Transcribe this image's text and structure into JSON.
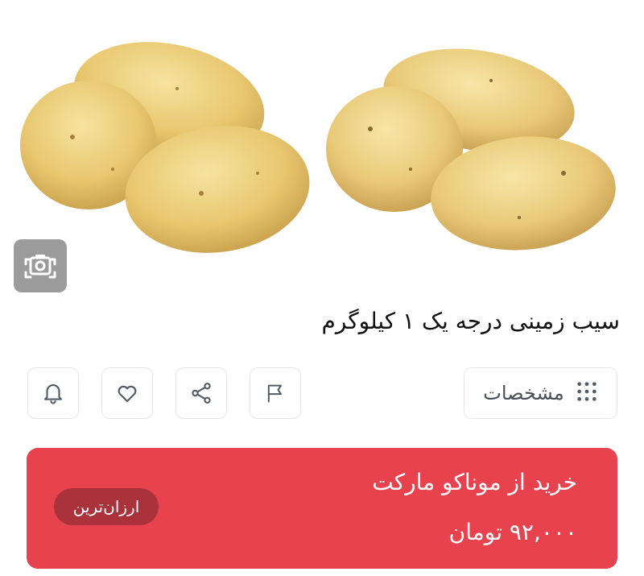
{
  "product": {
    "title": "سیب زمینی درجه یک ۱ کیلوگرم",
    "image_subject": "potatoes"
  },
  "gallery": {
    "camera_icon": "camera-icon"
  },
  "actions": {
    "specs_label": "مشخصات",
    "specs_icon": "grid-dots-icon",
    "icons": [
      "bell-icon",
      "heart-icon",
      "share-icon",
      "flag-icon"
    ]
  },
  "buy_card": {
    "title": "خرید از موناکو مارکت",
    "price": "۹۲,۰۰۰ تومان",
    "badge": "ارزان‌ترین",
    "background": "#e8424f",
    "badge_background": "#a9323c"
  }
}
